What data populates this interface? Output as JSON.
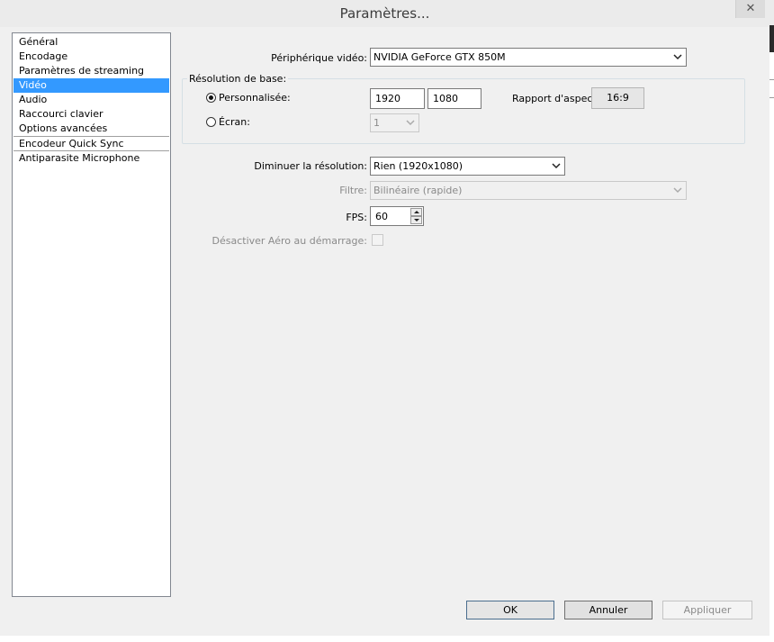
{
  "window": {
    "title": "Paramètres...",
    "close_glyph": "✕"
  },
  "sidebar": {
    "items": [
      {
        "label": "Général"
      },
      {
        "label": "Encodage"
      },
      {
        "label": "Paramètres de streaming"
      },
      {
        "label": "Vidéo",
        "selected": true
      },
      {
        "label": "Audio"
      },
      {
        "label": "Raccourci clavier"
      },
      {
        "label": "Options avancées"
      },
      {
        "label": "Encodeur Quick Sync"
      },
      {
        "label": "Antiparasite Microphone"
      }
    ]
  },
  "video": {
    "device_label": "Périphérique vidéo:",
    "device_value": "NVIDIA GeForce GTX 850M",
    "base_resolution_label": "Résolution de base:",
    "custom_label": "Personnalisée:",
    "custom_selected": true,
    "width": "1920",
    "height": "1080",
    "aspect_label": "Rapport d'aspect",
    "aspect_value": "16:9",
    "screen_label": "Écran:",
    "screen_value": "1",
    "downscale_label": "Diminuer la résolution:",
    "downscale_value": "Rien  (1920x1080)",
    "filter_label": "Filtre:",
    "filter_value": "Bilinéaire (rapide)",
    "fps_label": "FPS:",
    "fps_value": "60",
    "aero_label": "Désactiver Aéro au démarrage:"
  },
  "buttons": {
    "ok": "OK",
    "cancel": "Annuler",
    "apply": "Appliquer"
  }
}
